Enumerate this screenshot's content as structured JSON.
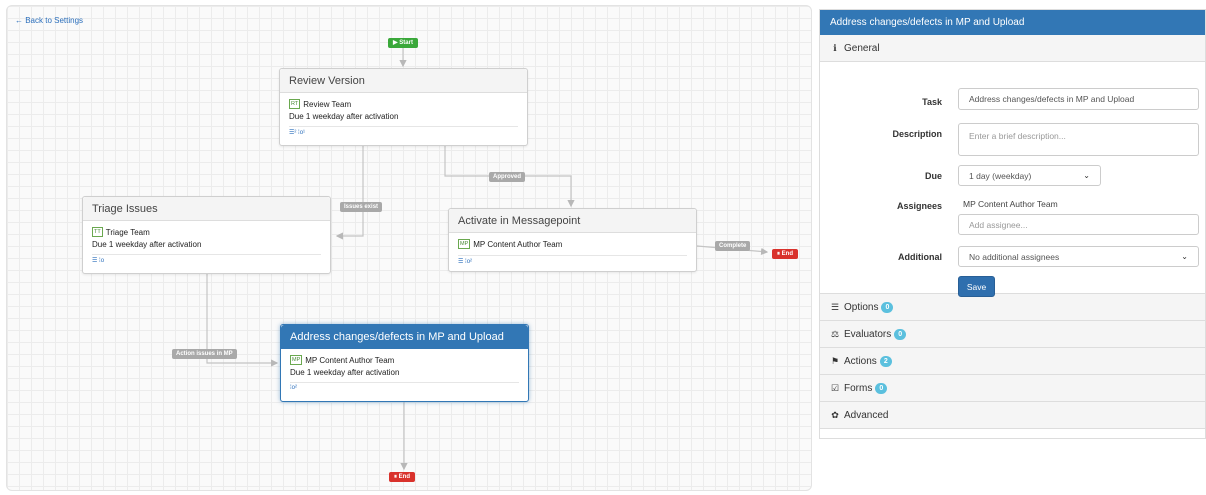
{
  "canvas": {
    "back_link": "← Back to Settings",
    "start_label": "▶ Start",
    "end_label": "⏸ End",
    "edge_labels": {
      "approved": "Approved",
      "issues_exist": "Issues exist",
      "complete": "Complete",
      "action_issues": "Action issues in MP"
    },
    "nodes": [
      {
        "title": "Review Version",
        "badge": "RT",
        "team": "Review Team",
        "due": "Due 1 weekday after activation",
        "footer": "☰² ⁞o¹"
      },
      {
        "title": "Triage Issues",
        "badge": "TT",
        "team": "Triage Team",
        "due": "Due 1 weekday after activation",
        "footer": "☰ ⁞o"
      },
      {
        "title": "Activate in Messagepoint",
        "badge": "MP",
        "team": "MP Content Author Team",
        "due": "",
        "footer": "☰ ⁞o²"
      },
      {
        "title": "Address changes/defects in MP and Upload",
        "badge": "MP",
        "team": "MP Content Author Team",
        "due": "Due 1 weekday after activation",
        "footer": "⁞o²"
      }
    ]
  },
  "panel": {
    "title": "Address changes/defects in MP and Upload",
    "general": {
      "label": "General",
      "task_label": "Task",
      "task_value": "Address changes/defects in MP and Upload",
      "description_label": "Description",
      "description_placeholder": "Enter a brief description...",
      "due_label": "Due",
      "due_value": "1 day (weekday)",
      "assignees_label": "Assignees",
      "assignee_name": "MP Content Author Team",
      "assignee_placeholder": "Add assignee...",
      "additional_label": "Additional",
      "additional_value": "No additional assignees",
      "save_label": "Save"
    },
    "sections": [
      {
        "label": "Options",
        "icon": "list-icon",
        "glyph": "☰",
        "count": "0"
      },
      {
        "label": "Evaluators",
        "icon": "scale-icon",
        "glyph": "⚖",
        "count": "0"
      },
      {
        "label": "Actions",
        "icon": "flag-icon",
        "glyph": "⚑",
        "count": "2"
      },
      {
        "label": "Forms",
        "icon": "checkbox-icon",
        "glyph": "☑",
        "count": "0"
      },
      {
        "label": "Advanced",
        "icon": "gear-icon",
        "glyph": "✿",
        "count": ""
      }
    ]
  },
  "colors": {
    "accent": "#3277b5",
    "start": "#3aa83a",
    "end": "#d9322c",
    "badge": "#5bc0de",
    "edge_label": "#a9a9a9"
  }
}
